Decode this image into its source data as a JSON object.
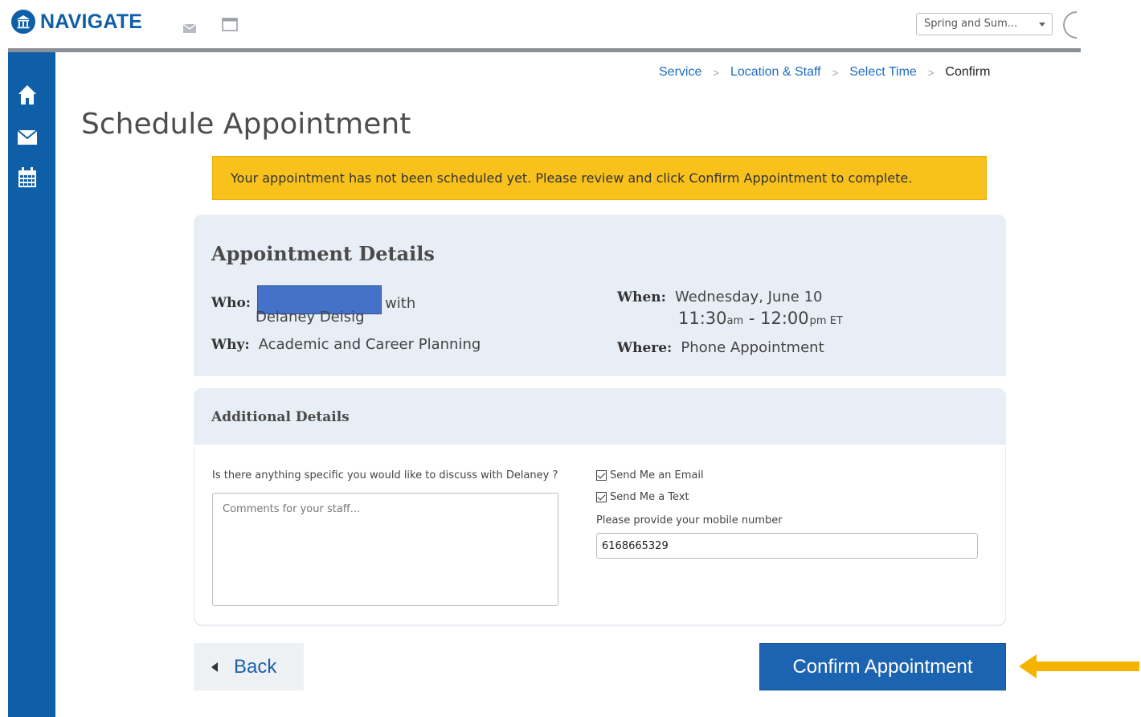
{
  "app": {
    "brand": "NAVIGATE"
  },
  "header": {
    "term_select": "Spring and Sum..."
  },
  "breadcrumb": {
    "items": [
      "Service",
      "Location & Staff",
      "Select Time"
    ],
    "current": "Confirm"
  },
  "page": {
    "title": "Schedule Appointment",
    "warning": "Your appointment has not been scheduled yet. Please review and click Confirm Appointment to complete."
  },
  "details": {
    "title": "Appointment Details",
    "who_label": "Who:",
    "with_text": "with",
    "staff": "Delaney Deisig",
    "why_label": "Why:",
    "why": "Academic and Career Planning",
    "when_label": "When:",
    "date": "Wednesday, June 10",
    "start": "11:30",
    "start_suffix": "am",
    "dash": " - ",
    "end": "12:00",
    "end_suffix": "pm ET",
    "where_label": "Where:",
    "where": "Phone Appointment"
  },
  "additional": {
    "title": "Additional Details",
    "question": "Is there anything specific you would like to discuss with Delaney ?",
    "comments_placeholder": "Comments for your staff...",
    "email_label": "Send Me an Email",
    "text_label": "Send Me a Text",
    "mobile_label": "Please provide your mobile number",
    "mobile_value": "6168665329"
  },
  "actions": {
    "back": "Back",
    "confirm": "Confirm Appointment"
  },
  "colors": {
    "brand": "#0f5fa8",
    "warning": "#f8c11c",
    "arrow": "#f5b300"
  },
  "icons": [
    "university-logo-icon",
    "mail-icon",
    "window-icon",
    "home-icon",
    "envelope-icon",
    "calendar-icon",
    "back-triangle-icon",
    "pointer-arrow-icon"
  ]
}
